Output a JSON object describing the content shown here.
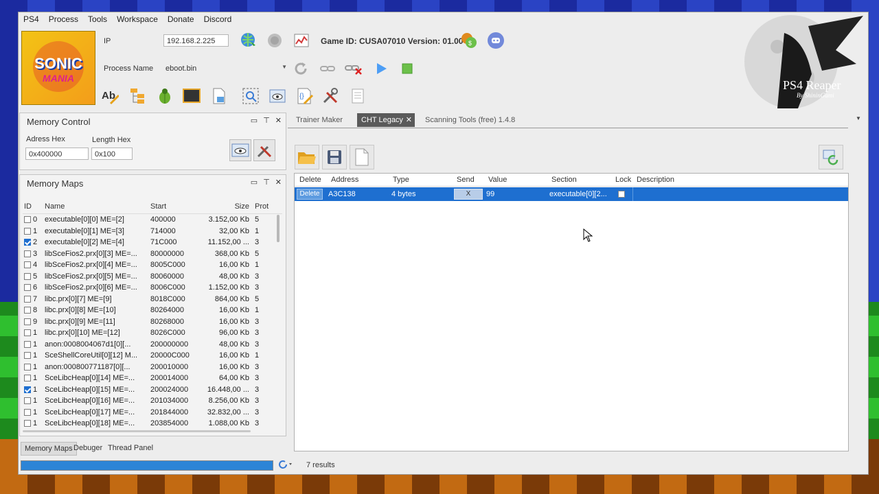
{
  "menu": [
    "PS4",
    "Process",
    "Tools",
    "Workspace",
    "Donate",
    "Discord"
  ],
  "cover": {
    "line1": "SONIC",
    "line2": "MANIA"
  },
  "connection": {
    "ip_label": "IP",
    "ip_value": "192.168.2.225",
    "process_label": "Process Name",
    "process_value": "eboot.bin",
    "game_info": "Game ID: CUSA07010 Version: 01.00"
  },
  "brand": {
    "title": "PS4 Reaper",
    "subtitle": "By ShininGami"
  },
  "memory_control": {
    "title": "Memory Control",
    "address_label": "Adress Hex",
    "address_value": "0x400000",
    "length_label": "Length Hex",
    "length_value": "0x100"
  },
  "memory_maps": {
    "title": "Memory Maps",
    "columns": {
      "id": "ID",
      "name": "Name",
      "start": "Start",
      "size": "Size",
      "prot": "Prot"
    },
    "rows": [
      {
        "id": "0",
        "name": "executable[0][0] ME=[2]",
        "start": "400000",
        "size": "3.152,00 Kb",
        "prot": "5",
        "checked": false
      },
      {
        "id": "1",
        "name": "executable[0][1] ME=[3]",
        "start": "714000",
        "size": "32,00 Kb",
        "prot": "1",
        "checked": false
      },
      {
        "id": "2",
        "name": "executable[0][2] ME=[4]",
        "start": "71C000",
        "size": "11.152,00 ...",
        "prot": "3",
        "checked": true
      },
      {
        "id": "3",
        "name": "libSceFios2.prx[0][3] ME=...",
        "start": "80000000",
        "size": "368,00 Kb",
        "prot": "5",
        "checked": false
      },
      {
        "id": "4",
        "name": "libSceFios2.prx[0][4] ME=...",
        "start": "8005C000",
        "size": "16,00 Kb",
        "prot": "1",
        "checked": false
      },
      {
        "id": "5",
        "name": "libSceFios2.prx[0][5] ME=...",
        "start": "80060000",
        "size": "48,00 Kb",
        "prot": "3",
        "checked": false
      },
      {
        "id": "6",
        "name": "libSceFios2.prx[0][6] ME=...",
        "start": "8006C000",
        "size": "1.152,00 Kb",
        "prot": "3",
        "checked": false
      },
      {
        "id": "7",
        "name": "libc.prx[0][7] ME=[9]",
        "start": "8018C000",
        "size": "864,00 Kb",
        "prot": "5",
        "checked": false
      },
      {
        "id": "8",
        "name": "libc.prx[0][8] ME=[10]",
        "start": "80264000",
        "size": "16,00 Kb",
        "prot": "1",
        "checked": false
      },
      {
        "id": "9",
        "name": "libc.prx[0][9] ME=[11]",
        "start": "80268000",
        "size": "16,00 Kb",
        "prot": "3",
        "checked": false
      },
      {
        "id": "1",
        "name": "libc.prx[0][10] ME=[12]",
        "start": "8026C000",
        "size": "96,00 Kb",
        "prot": "3",
        "checked": false
      },
      {
        "id": "1",
        "name": "anon:0008004067d1[0][...",
        "start": "200000000",
        "size": "48,00 Kb",
        "prot": "3",
        "checked": false
      },
      {
        "id": "1",
        "name": "SceShellCoreUtil[0][12] M...",
        "start": "20000C000",
        "size": "16,00 Kb",
        "prot": "1",
        "checked": false
      },
      {
        "id": "1",
        "name": "anon:000800771187[0][...",
        "start": "200010000",
        "size": "16,00 Kb",
        "prot": "3",
        "checked": false
      },
      {
        "id": "1",
        "name": "SceLibcHeap[0][14] ME=...",
        "start": "200014000",
        "size": "64,00 Kb",
        "prot": "3",
        "checked": false
      },
      {
        "id": "1",
        "name": "SceLibcHeap[0][15] ME=...",
        "start": "200024000",
        "size": "16.448,00 ...",
        "prot": "3",
        "checked": true
      },
      {
        "id": "1",
        "name": "SceLibcHeap[0][16] ME=...",
        "start": "201034000",
        "size": "8.256,00 Kb",
        "prot": "3",
        "checked": false
      },
      {
        "id": "1",
        "name": "SceLibcHeap[0][17] ME=...",
        "start": "201844000",
        "size": "32.832,00 ...",
        "prot": "3",
        "checked": false
      },
      {
        "id": "1",
        "name": "SceLibcHeap[0][18] ME=...",
        "start": "203854000",
        "size": "1.088,00 Kb",
        "prot": "3",
        "checked": false
      }
    ]
  },
  "bottom_tabs": [
    "Memory Maps",
    "Debuger",
    "Thread Panel"
  ],
  "doc_tabs": {
    "trainer": "Trainer Maker",
    "cht": "CHT Legacy",
    "close": "✕",
    "scan": "Scanning Tools (free) 1.4.8"
  },
  "cht_grid": {
    "columns": {
      "delete": "Delete",
      "address": "Address",
      "type": "Type",
      "send": "Send",
      "value": "Value",
      "section": "Section",
      "lock": "Lock",
      "description": "Description"
    },
    "row": {
      "delete": "Delete",
      "address": "A3C138",
      "type": "4 bytes",
      "send": "X",
      "value": "99",
      "section": "executable[0][2...",
      "description": ""
    }
  },
  "status": {
    "results": "7 results",
    "progress_fraction": 1.0
  },
  "colors": {
    "selection": "#1e6fd0",
    "window": "#ededed",
    "accent_tab": "#5a5a5a"
  }
}
